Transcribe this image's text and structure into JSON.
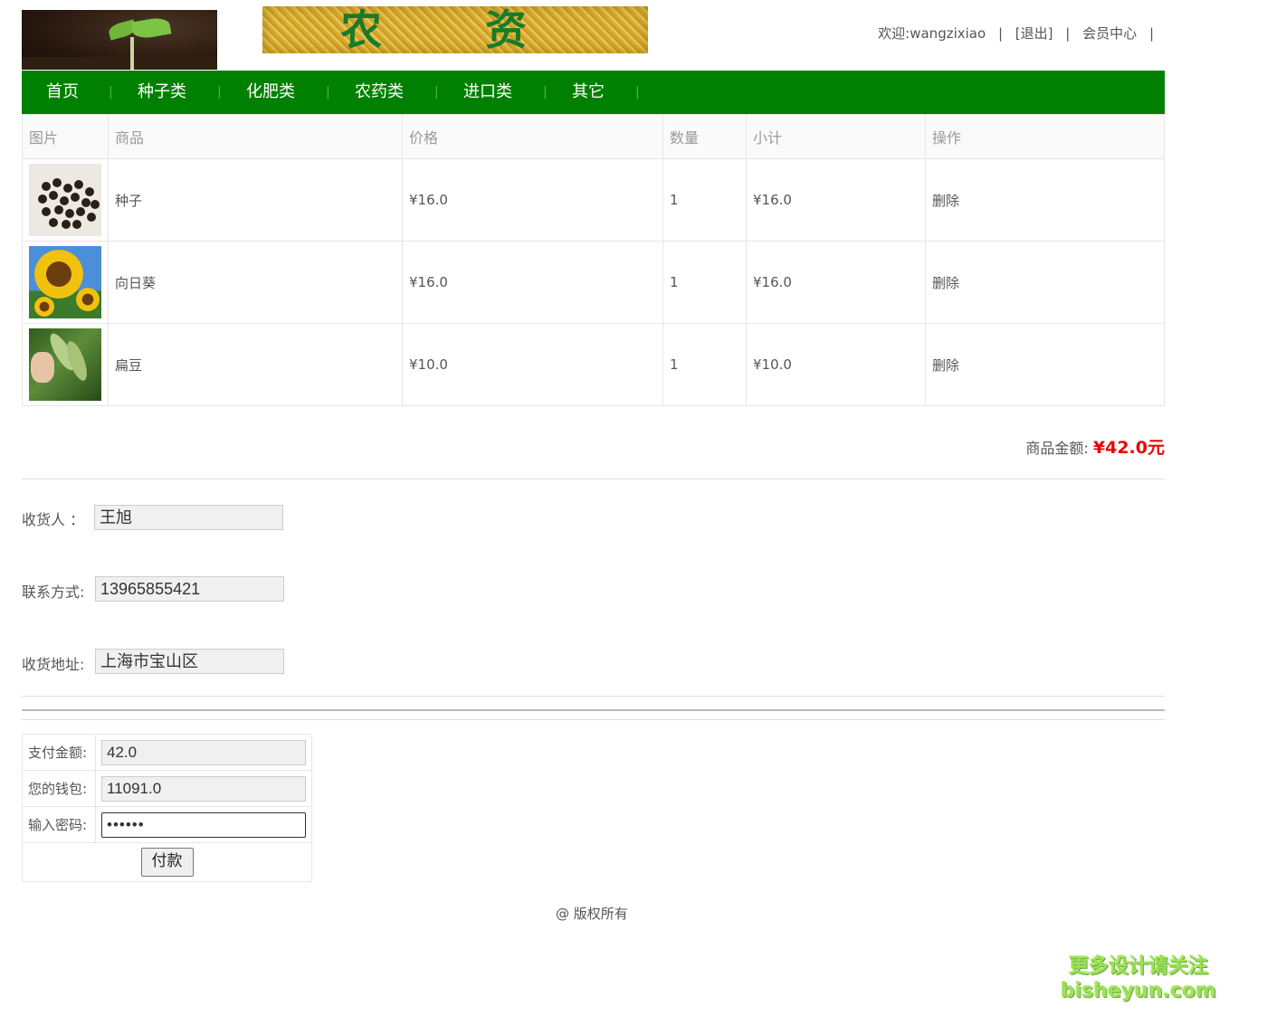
{
  "header": {
    "banner_chars": [
      "农",
      "资"
    ],
    "welcome": "欢迎:wangzixiao",
    "logout": "[退出]",
    "member_center": "会员中心",
    "sep": "|"
  },
  "nav": {
    "items": [
      "首页",
      "种子类",
      "化肥类",
      "农药类",
      "进口类",
      "其它"
    ],
    "sep": "|"
  },
  "cart": {
    "columns": [
      "图片",
      "商品",
      "价格",
      "数量",
      "小计",
      "操作"
    ],
    "rows": [
      {
        "image": "seeds-image",
        "name": "种子",
        "price": "¥16.0",
        "qty": "1",
        "subtotal": "¥16.0",
        "action": "删除"
      },
      {
        "image": "sunflower-image",
        "name": "向日葵",
        "price": "¥16.0",
        "qty": "1",
        "subtotal": "¥16.0",
        "action": "删除"
      },
      {
        "image": "bean-image",
        "name": "扁豆",
        "price": "¥10.0",
        "qty": "1",
        "subtotal": "¥10.0",
        "action": "删除"
      }
    ],
    "total_label": "商品金额:",
    "total_value": "¥42.0元"
  },
  "shipping": {
    "receiver_label": "收货人 ：",
    "receiver_value": "王旭",
    "phone_label": "联系方式:",
    "phone_value": "13965855421",
    "address_label": "收货地址:",
    "address_value": "上海市宝山区"
  },
  "payment": {
    "amount_label": "支付金额:",
    "amount_value": "42.0",
    "wallet_label": "您的钱包:",
    "wallet_value": "11091.0",
    "password_label": "输入密码:",
    "password_value": "••••••",
    "pay_button": "付款"
  },
  "footer": {
    "copyright": "@ 版权所有"
  },
  "watermark": {
    "line1": "更多设计请关注",
    "line2": "bisheyun.com"
  },
  "colors": {
    "nav_green": "#008000",
    "price_red": "#e4080a"
  }
}
